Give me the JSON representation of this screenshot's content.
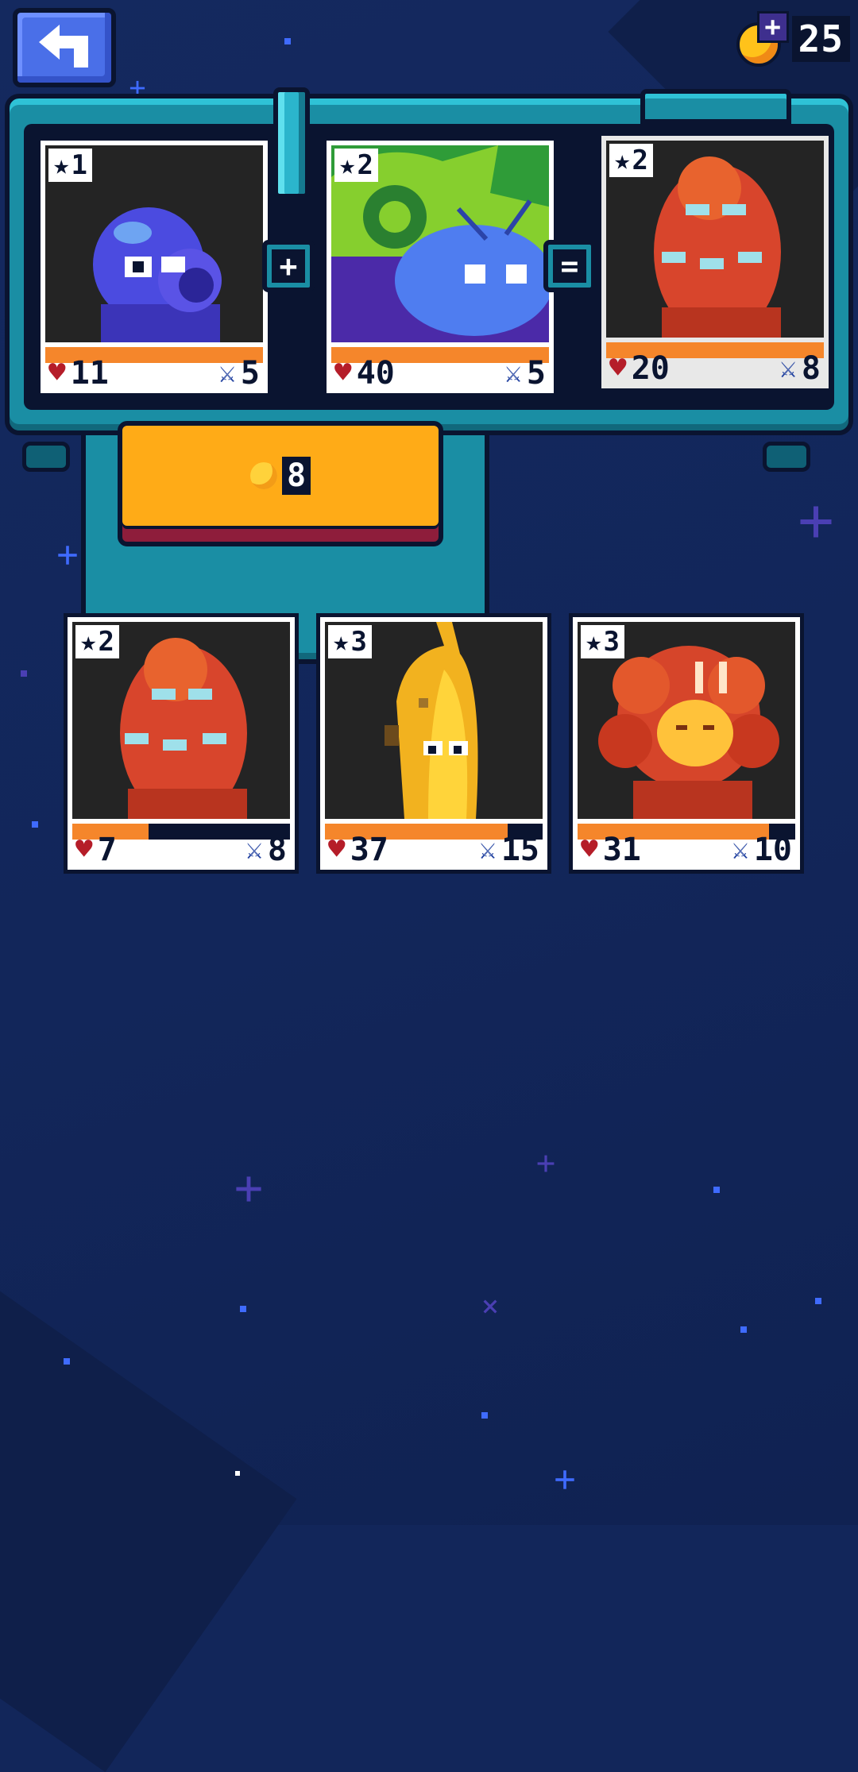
{
  "header": {
    "back_label": "Back",
    "coins": "25",
    "icons": {
      "back": "back-arrow-icon",
      "coin_shop": "coin-plus-icon"
    }
  },
  "merge": {
    "plus_sign": "+",
    "equals_sign": "=",
    "cost": "8",
    "slot_a": {
      "stars": "1",
      "hp": "11",
      "attack": "5",
      "hp_fraction": 1.0,
      "creature": "blue-octopus"
    },
    "slot_b": {
      "stars": "2",
      "hp": "40",
      "attack": "5",
      "hp_fraction": 1.0,
      "creature": "green-shell-snail"
    },
    "result": {
      "stars": "2",
      "hp": "20",
      "attack": "8",
      "hp_fraction": 1.0,
      "creature": "red-many-eyed-blob"
    }
  },
  "inventory": [
    {
      "stars": "2",
      "hp": "7",
      "attack": "8",
      "hp_fraction": 0.35,
      "creature": "red-many-eyed-blob"
    },
    {
      "stars": "3",
      "hp": "37",
      "attack": "15",
      "hp_fraction": 0.84,
      "creature": "yellow-banana-creature"
    },
    {
      "stars": "3",
      "hp": "31",
      "attack": "10",
      "hp_fraction": 0.88,
      "creature": "orange-flower-beast"
    }
  ],
  "colors": {
    "background": "#12265a",
    "machine": "#1a8ea4",
    "button": "#ffab17",
    "hp_bar": "#f5862b",
    "heart": "#b51d29",
    "sword": "#1c3d9e"
  }
}
